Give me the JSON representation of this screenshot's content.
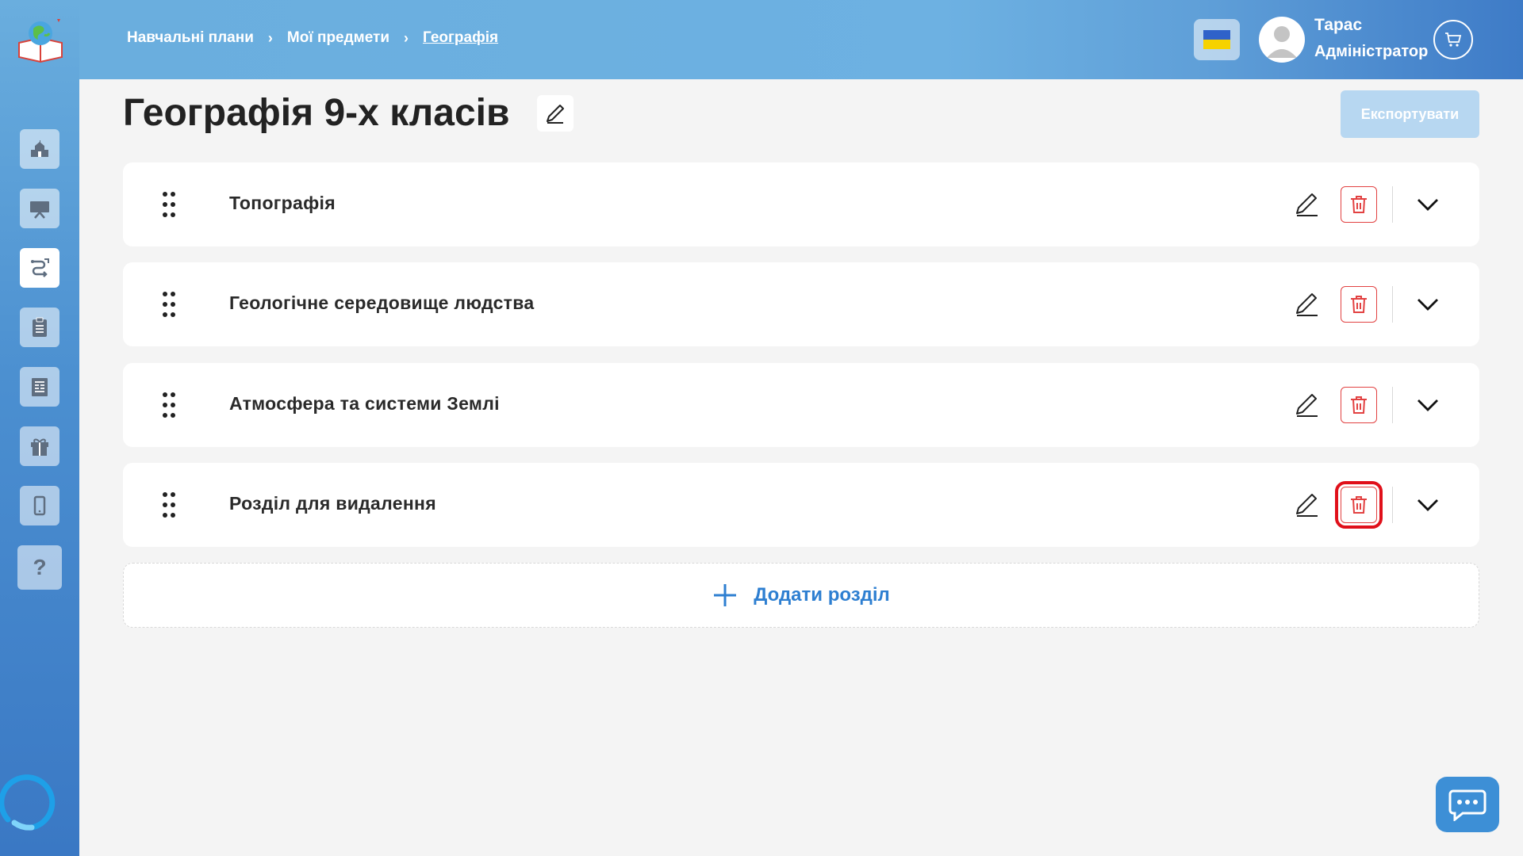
{
  "breadcrumb": {
    "item1": "Навчальні плани",
    "item2": "Мої предмети",
    "current": "Географія",
    "separator": "›"
  },
  "user": {
    "name": "Тарас",
    "role": "Адміністратор"
  },
  "page": {
    "title": "Географія 9-х класів",
    "export_label": "Експортувати"
  },
  "sections": [
    {
      "title": "Топографія"
    },
    {
      "title": "Геологічне середовище людства"
    },
    {
      "title": "Атмосфера та системи Землі"
    },
    {
      "title": "Розділ для видалення"
    }
  ],
  "add_section_label": "Додати розділ",
  "help_label": "?",
  "colors": {
    "accent": "#2e7fd1",
    "danger": "#e24141",
    "highlight": "#e0101a",
    "sidebar_top": "#6aaede",
    "sidebar_bottom": "#3a78c4",
    "export_disabled": "#b7d7f1"
  },
  "icons": {
    "sidebar": [
      "school-icon",
      "presentation-icon",
      "curriculum-icon",
      "clipboard-icon",
      "journal-icon",
      "gift-icon",
      "mobile-icon",
      "help-icon"
    ],
    "row": [
      "drag-handle-icon",
      "pencil-icon",
      "trash-icon",
      "chevron-down-icon"
    ]
  }
}
